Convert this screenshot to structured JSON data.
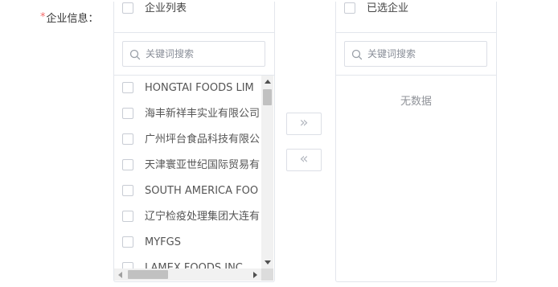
{
  "form": {
    "required_mark": "*",
    "label": "企业信息："
  },
  "source_panel": {
    "title": "企业列表",
    "search_placeholder": "关键词搜索",
    "items": [
      {
        "label": "HONGTAI FOODS LIM"
      },
      {
        "label": "海丰新祥丰实业有限公司"
      },
      {
        "label": "广州坪台食品科技有限公"
      },
      {
        "label": "天津寰亚世纪国际贸易有"
      },
      {
        "label": "SOUTH AMERICA FOO"
      },
      {
        "label": "辽宁检疫处理集团大连有"
      },
      {
        "label": "MYFGS"
      },
      {
        "label": "LAMEX FOODS INC"
      }
    ]
  },
  "target_panel": {
    "title": "已选企业",
    "search_placeholder": "关键词搜索",
    "empty_text": "无数据"
  },
  "buttons": {
    "move_right_symbol": "»",
    "move_left_symbol": "«"
  },
  "icons": {
    "search": "search-icon",
    "checkbox": "checkbox-icon",
    "move_right": "double-chevron-right-icon",
    "move_left": "double-chevron-left-icon"
  }
}
